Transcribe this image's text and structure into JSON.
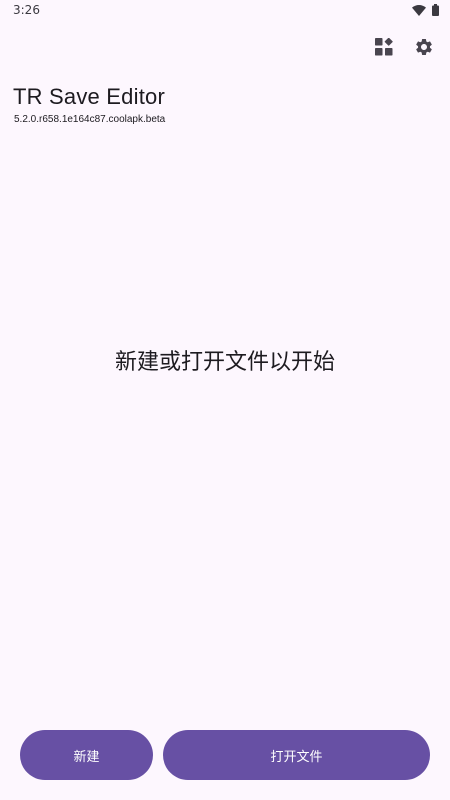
{
  "status_bar": {
    "time": "3:26",
    "icons": [
      "wifi-icon",
      "battery-icon"
    ]
  },
  "toolbar": {
    "actions": [
      {
        "name": "widgets-icon"
      },
      {
        "name": "settings-icon"
      }
    ]
  },
  "app": {
    "title": "TR Save Editor",
    "version": "5.2.0.r658.1e164c87.coolapk.beta"
  },
  "main": {
    "empty_message": "新建或打开文件以开始"
  },
  "actions": {
    "new_label": "新建",
    "open_label": "打开文件"
  },
  "colors": {
    "background": "#fdf7fe",
    "primary": "#6750a4",
    "on_primary": "#ffffff",
    "icon": "#49454f"
  }
}
